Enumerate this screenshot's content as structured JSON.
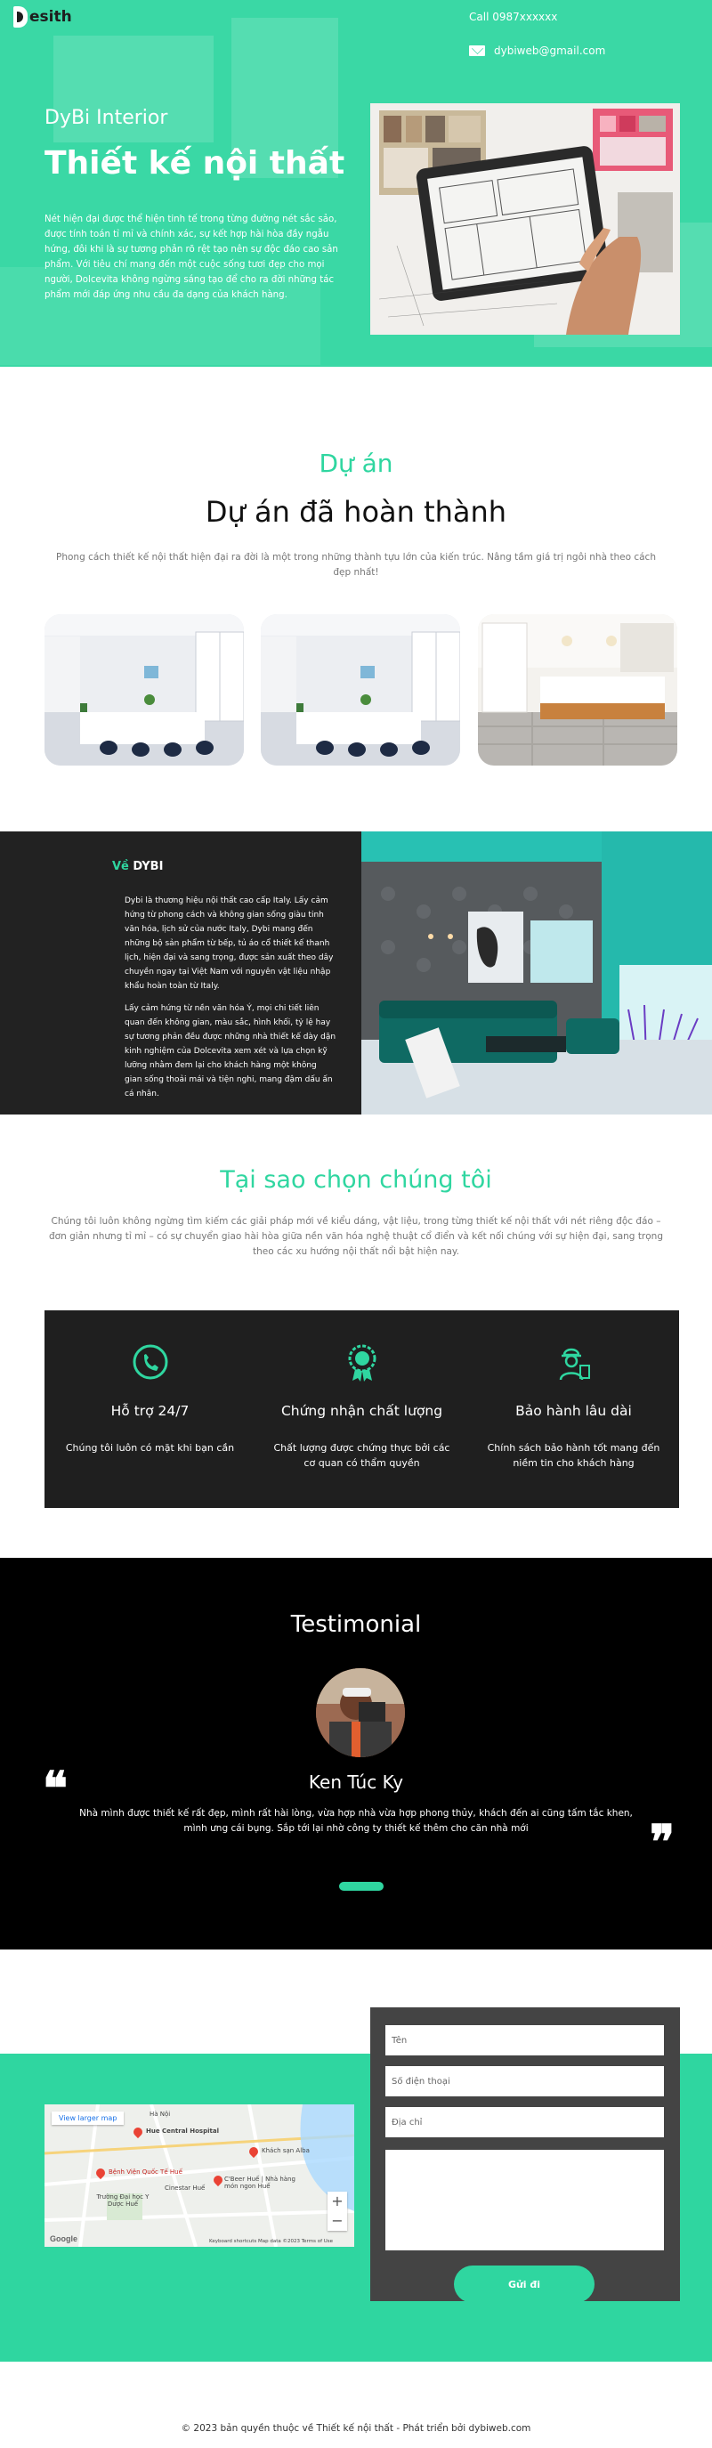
{
  "header": {
    "logo_text": "esith",
    "phone": "Call 0987xxxxxx",
    "email": "dybiweb@gmail.com",
    "icons": [
      "logo-d-icon",
      "mail-icon"
    ]
  },
  "hero": {
    "subtitle": "DyBi Interior",
    "title": "Thiết kế nội thất",
    "text": "Nét hiện đại được thể hiện tinh tế trong từng đường nét sắc sảo, được tính toán tỉ mỉ và chính xác, sự kết hợp hài hòa đầy ngẫu hứng, đôi khi là sự tương phản rõ rệt tạo nên sự độc đáo cao sản phẩm. Với tiêu chí mang đến một cuộc sống tươi đẹp cho mọi người, Dolcevita không ngừng sáng tạo để cho ra đời những tác phẩm mới đáp ứng nhu cầu đa dạng của khách hàng."
  },
  "projects": {
    "kicker": "Dự án",
    "title": "Dự án đã hoàn thành",
    "description": "Phong cách thiết kế nội thất hiện đại ra đời là một trong những thành tựu lớn của kiến trúc. Nâng tầm giá trị ngôi nhà theo cách đẹp nhất!"
  },
  "about": {
    "title_accent": "Về",
    "title_rest": " DYBI",
    "paragraph1": "Dybi là thương hiệu nội thất cao cấp Italy. Lấy cảm hứng từ phong cách và không gian sống giàu tinh văn hóa, lịch sử của nước Italy, Dybi mang đến những bộ sản phẩm từ bếp, tủ áo cổ thiết kế thanh lịch, hiện đại và sang trọng, được sản xuất theo dây chuyền ngay tại Việt Nam với nguyên vật liệu nhập khẩu hoàn toàn từ Italy.",
    "paragraph2": "Lấy cảm hứng từ nền văn hóa Ý, mọi chi tiết liên quan đến không gian, màu sắc, hình khối, tỷ lệ hay sự tương phản đều được những nhà thiết kế dày dặn kinh nghiệm của Dolcevita xem xét và lựa chọn kỹ lưỡng nhằm đem lại cho khách hàng một không gian sống thoải mái và tiện nghi, mang đậm dấu ấn cá nhân."
  },
  "why": {
    "title": "Tại sao chọn chúng tôi",
    "description": "Chúng tôi luôn không ngừng tìm kiếm các giải pháp mới về kiểu dáng, vật liệu, trong từng thiết kế nội thất với nét riêng độc đáo – đơn giản nhưng tỉ mỉ – có sự chuyển giao hài hòa giữa nền văn hóa nghệ thuật cổ điển và kết nối chúng với sự hiện đại, sang trọng theo các xu hướng nội thất nổi bật hiện nay.",
    "items": [
      {
        "title": "Hỗ trợ 24/7",
        "text": "Chúng tôi luôn có mặt khi bạn cần",
        "icon": "phone-icon"
      },
      {
        "title": "Chứng nhận chất lượng",
        "text": "Chất lượng được chứng thực bởi các cơ quan có thẩm quyền",
        "icon": "award-icon"
      },
      {
        "title": "Bảo hành lâu dài",
        "text": "Chính sách bảo hành tốt mang đến niềm tin cho khách hàng",
        "icon": "worker-icon"
      }
    ]
  },
  "testimonial": {
    "title": "Testimonial",
    "name": "Ken Túc Ky",
    "text": "Nhà mình được thiết kế rất đẹp, mình rất hài lòng, vừa hợp nhà vừa hợp phong thủy, khách đến ai cũng tấm tắc khen, mình ưng cái bụng. Sắp tới lại nhờ công ty thiết kế thêm cho căn nhà mới",
    "quote_open": "❝",
    "quote_close": "❞"
  },
  "map": {
    "button": "View larger map",
    "labels": {
      "ha_noi": "Hà Nội",
      "hospital": "Hue Central Hospital",
      "khach_san": "Khách sạn Alba",
      "benh_vien": "Bệnh Viện Quốc Tế Huế",
      "cineplex": "Cinestar Huế",
      "restaurant": "C'Beer Huế | Nhà hàng món ngon Huế",
      "truong": "Trường Đại học Y Dược Huế"
    },
    "google": "Google",
    "footer": "Keyboard shortcuts   Map data ©2023   Terms of Use"
  },
  "form": {
    "name_placeholder": "Tên",
    "phone_placeholder": "Số điện thoại",
    "address_placeholder": "Địa chỉ",
    "message_placeholder": "",
    "submit_label": "Gửi đi"
  },
  "footer": {
    "text": "© 2023 bản quyền thuộc về Thiết kế nội thất - Phát triển bởi dybiweb.com"
  },
  "colors": {
    "accent": "#2fd6a0",
    "dark": "#222222",
    "form_bg": "#444444"
  }
}
